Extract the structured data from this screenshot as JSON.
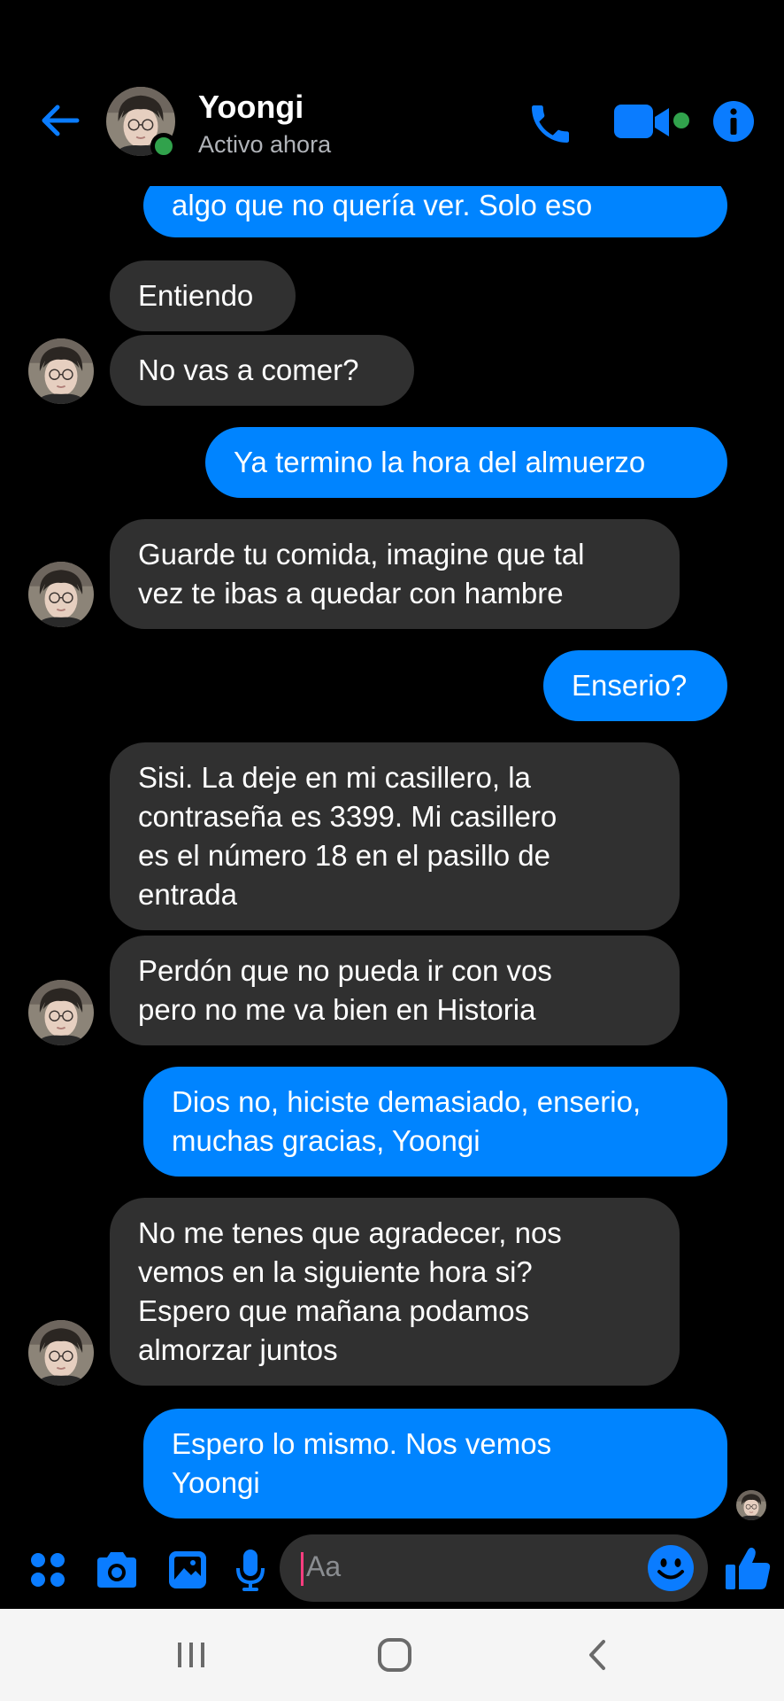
{
  "header": {
    "name": "Yoongi",
    "status": "Activo ahora"
  },
  "messages": [
    {
      "side": "out",
      "lines": [
        "algo que no quería ver. Solo eso"
      ]
    },
    {
      "side": "in",
      "lines": [
        "Entiendo"
      ]
    },
    {
      "side": "in",
      "lines": [
        "No vas a comer?"
      ]
    },
    {
      "side": "out",
      "lines": [
        "Ya termino la hora del almuerzo"
      ]
    },
    {
      "side": "in",
      "lines": [
        "Guarde tu comida, imagine que tal",
        "vez te ibas a quedar con hambre"
      ]
    },
    {
      "side": "out",
      "lines": [
        "Enserio?"
      ]
    },
    {
      "side": "in",
      "lines": [
        "Sisi. La deje en mi casillero, la",
        "contraseña es 3399. Mi casillero",
        "es el número 18 en el pasillo de",
        "entrada"
      ]
    },
    {
      "side": "in",
      "lines": [
        "Perdón que no pueda ir con vos",
        "pero no me va bien en Historia"
      ]
    },
    {
      "side": "out",
      "lines": [
        "Dios no, hiciste demasiado, enserio,",
        "muchas gracias, Yoongi"
      ]
    },
    {
      "side": "in",
      "lines": [
        "No me tenes que agradecer, nos",
        "vemos en la siguiente hora si?",
        "Espero que mañana podamos",
        "almorzar juntos"
      ]
    },
    {
      "side": "out",
      "lines": [
        "Espero lo mismo. Nos vemos",
        "Yoongi"
      ]
    }
  ],
  "composer": {
    "placeholder": "Aa"
  },
  "colors": {
    "accent": "#0084ff",
    "incoming_bubble": "#303030",
    "online": "#31a24c",
    "background": "#000000"
  },
  "icons": {
    "header": [
      "back-arrow-icon",
      "phone-icon",
      "video-camera-icon",
      "info-icon"
    ],
    "composer": [
      "apps-grid-icon",
      "camera-icon",
      "gallery-icon",
      "microphone-icon",
      "emoji-icon",
      "thumbs-up-icon"
    ],
    "navbar": [
      "recent-apps-icon",
      "home-icon",
      "back-icon"
    ]
  }
}
